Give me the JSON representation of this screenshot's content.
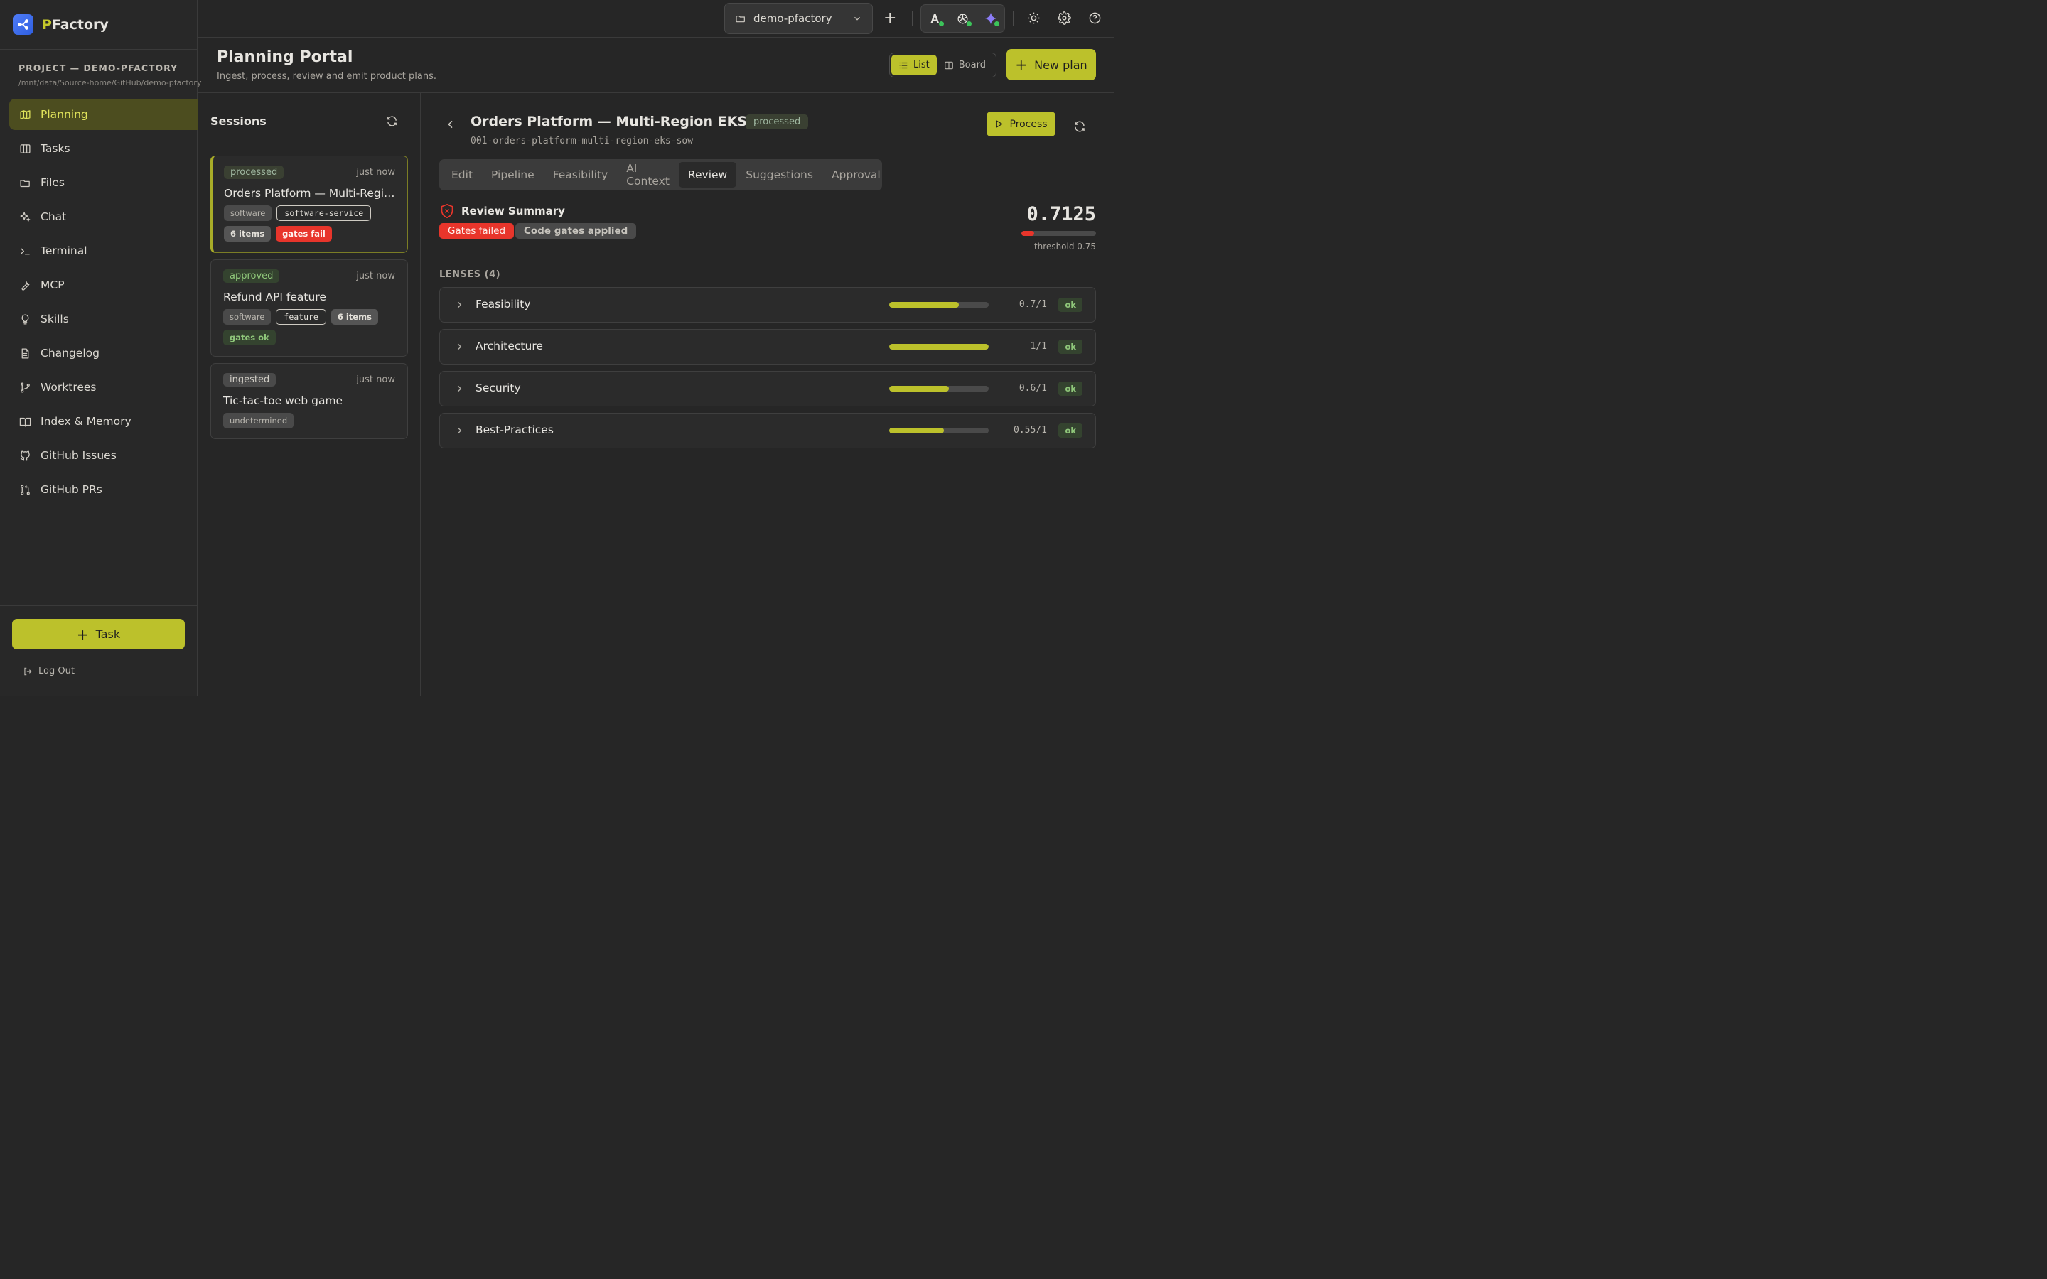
{
  "app": {
    "name_prefix": "P",
    "name_rest": "Factory"
  },
  "project": {
    "label": "PROJECT — DEMO-PFACTORY",
    "path": "/mnt/data/Source-home/GitHub/demo-pfactory"
  },
  "nav": [
    {
      "label": "Planning",
      "icon": "map-icon",
      "active": true
    },
    {
      "label": "Tasks",
      "icon": "columns-icon"
    },
    {
      "label": "Files",
      "icon": "folder-icon"
    },
    {
      "label": "Chat",
      "icon": "sparkles-icon"
    },
    {
      "label": "Terminal",
      "icon": "terminal-icon"
    },
    {
      "label": "MCP",
      "icon": "wrench-icon"
    },
    {
      "label": "Skills",
      "icon": "lightbulb-icon"
    },
    {
      "label": "Changelog",
      "icon": "file-text-icon"
    },
    {
      "label": "Worktrees",
      "icon": "git-branch-icon"
    },
    {
      "label": "Index & Memory",
      "icon": "book-icon"
    },
    {
      "label": "GitHub Issues",
      "icon": "github-icon"
    },
    {
      "label": "GitHub PRs",
      "icon": "git-pull-request-icon"
    }
  ],
  "sidebar_bottom": {
    "task_label": "Task",
    "logout_label": "Log Out"
  },
  "topbar": {
    "project_select": "demo-pfactory"
  },
  "header": {
    "title": "Planning Portal",
    "subtitle": "Ingest, process, review and emit product plans.",
    "view_list": "List",
    "view_board": "Board",
    "new_plan": "New plan"
  },
  "sessions": {
    "title": "Sessions",
    "cards": [
      {
        "status": "processed",
        "time": "just now",
        "title": "Orders Platform — Multi-Region ...",
        "tags": [
          {
            "text": "software",
            "style": "gray"
          },
          {
            "text": "software-service",
            "style": "outline"
          },
          {
            "text": "6 items",
            "style": "dark"
          },
          {
            "text": "gates fail",
            "style": "red"
          }
        ]
      },
      {
        "status": "approved",
        "time": "just now",
        "title": "Refund API feature",
        "tags": [
          {
            "text": "software",
            "style": "gray"
          },
          {
            "text": "feature",
            "style": "outline"
          },
          {
            "text": "6 items",
            "style": "dark"
          },
          {
            "text": "gates ok",
            "style": "green"
          }
        ]
      },
      {
        "status": "ingested",
        "time": "just now",
        "title": "Tic-tac-toe web game",
        "tags": [
          {
            "text": "undetermined",
            "style": "gray"
          }
        ]
      }
    ]
  },
  "detail": {
    "title": "Orders Platform — Multi-Region EKS SOW",
    "status": "processed",
    "slug": "001-orders-platform-multi-region-eks-sow",
    "process_label": "Process",
    "tabs": [
      "Edit",
      "Pipeline",
      "Feasibility",
      "AI Context",
      "Review",
      "Suggestions",
      "Approval"
    ],
    "active_tab": "Review",
    "review": {
      "title": "Review Summary",
      "badge_fail": "Gates failed",
      "badge_code": "Code gates applied",
      "score": "0.7125",
      "score_fraction": 0.17,
      "threshold": "threshold 0.75"
    },
    "lenses_label": "LENSES (4)",
    "lenses": [
      {
        "name": "Feasibility",
        "value": "0.7/1",
        "fraction": 0.7,
        "status": "ok"
      },
      {
        "name": "Architecture",
        "value": "1/1",
        "fraction": 1.0,
        "status": "ok"
      },
      {
        "name": "Security",
        "value": "0.6/1",
        "fraction": 0.6,
        "status": "ok"
      },
      {
        "name": "Best-Practices",
        "value": "0.55/1",
        "fraction": 0.55,
        "status": "ok"
      }
    ]
  },
  "colors": {
    "accent": "#bcc12b",
    "danger": "#e8352b",
    "ok": "#8fc77a"
  }
}
